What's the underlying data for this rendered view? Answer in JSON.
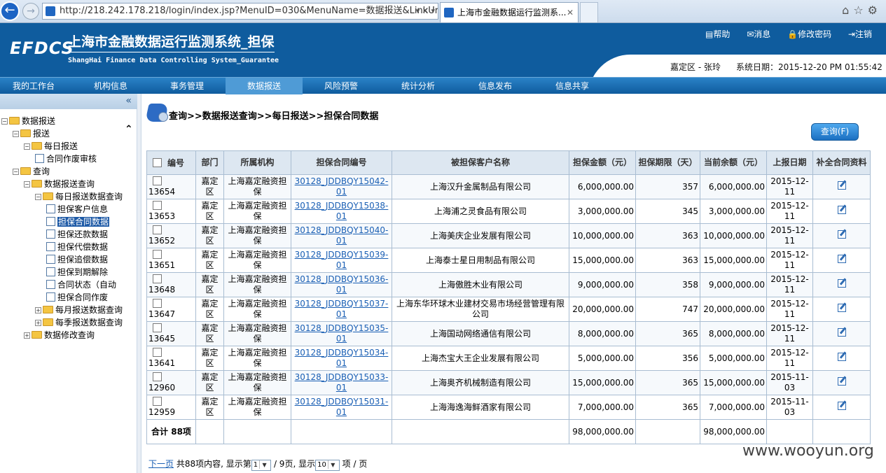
{
  "browser": {
    "url": "http://218.242.178.218/login/index.jsp?MenuID=030&MenuName=数据报送&LinkUr",
    "tab_title": "上海市金融数据运行监测系...",
    "back": "←",
    "forward": "→"
  },
  "header": {
    "logo": "EFDCS",
    "system_name": "上海市金融数据运行监测系统_担保",
    "system_name_en": "ShangHai Finance Data Controlling System_Guarantee",
    "links": [
      "帮助",
      "消息",
      "修改密码",
      "注销"
    ],
    "user": "嘉定区 - 张玲",
    "system_date_label": "系统日期：",
    "system_date": "2015-12-20 PM 01:55:42"
  },
  "nav": {
    "items": [
      "我的工作台",
      "机构信息",
      "事务管理",
      "数据报送",
      "风险预警",
      "统计分析",
      "信息发布",
      "信息共享"
    ],
    "active_index": 3
  },
  "tree": {
    "collapse_label": "«",
    "nodes": [
      {
        "label": "数据报送",
        "level": 0,
        "type": "folder",
        "pm": "−"
      },
      {
        "label": "报送",
        "level": 1,
        "type": "folder",
        "pm": "−"
      },
      {
        "label": "每日报送",
        "level": 2,
        "type": "folder",
        "pm": "−"
      },
      {
        "label": "合同作废审核",
        "level": 3,
        "type": "doc"
      },
      {
        "label": "查询",
        "level": 1,
        "type": "folder",
        "pm": "−"
      },
      {
        "label": "数据报送查询",
        "level": 2,
        "type": "folder",
        "pm": "−"
      },
      {
        "label": "每日报送数据查询",
        "level": 3,
        "type": "folder",
        "pm": "−"
      },
      {
        "label": "担保客户信息",
        "level": 4,
        "type": "doc"
      },
      {
        "label": "担保合同数据",
        "level": 4,
        "type": "doc",
        "selected": true
      },
      {
        "label": "担保还款数据",
        "level": 4,
        "type": "doc"
      },
      {
        "label": "担保代偿数据",
        "level": 4,
        "type": "doc"
      },
      {
        "label": "担保追偿数据",
        "level": 4,
        "type": "doc"
      },
      {
        "label": "担保到期解除",
        "level": 4,
        "type": "doc"
      },
      {
        "label": "合同状态（自动",
        "level": 4,
        "type": "doc"
      },
      {
        "label": "担保合同作废",
        "level": 4,
        "type": "doc"
      },
      {
        "label": "每月报送数据查询",
        "level": 3,
        "type": "folder",
        "pm": "+"
      },
      {
        "label": "每季报送数据查询",
        "level": 3,
        "type": "folder",
        "pm": "+"
      },
      {
        "label": "数据修改查询",
        "level": 2,
        "type": "folder",
        "pm": "+"
      }
    ]
  },
  "main": {
    "breadcrumb": "查询>>数据报送查询>>每日报送>>担保合同数据",
    "query_button": "查询(F)",
    "columns": [
      "编号",
      "部门",
      "所属机构",
      "担保合同编号",
      "被担保客户名称",
      "担保金额（元）",
      "担保期限（天）",
      "当前余额（元）",
      "上报日期",
      "补全合同资料"
    ],
    "rows": [
      {
        "id": "13654",
        "dept": "嘉定区",
        "org": "上海嘉定融资担保",
        "contract": "30128_JDDBQY15042-01",
        "client": "上海汉升金属制品有限公司",
        "amount": "6,000,000.00",
        "days": "357",
        "balance": "6,000,000.00",
        "date": "2015-12-11"
      },
      {
        "id": "13653",
        "dept": "嘉定区",
        "org": "上海嘉定融资担保",
        "contract": "30128_JDDBQY15038-01",
        "client": "上海浦之灵食品有限公司",
        "amount": "3,000,000.00",
        "days": "345",
        "balance": "3,000,000.00",
        "date": "2015-12-11"
      },
      {
        "id": "13652",
        "dept": "嘉定区",
        "org": "上海嘉定融资担保",
        "contract": "30128_JDDBQY15040-01",
        "client": "上海美庆企业发展有限公司",
        "amount": "10,000,000.00",
        "days": "363",
        "balance": "10,000,000.00",
        "date": "2015-12-11"
      },
      {
        "id": "13651",
        "dept": "嘉定区",
        "org": "上海嘉定融资担保",
        "contract": "30128_JDDBQY15039-01",
        "client": "上海泰士星日用制品有限公司",
        "amount": "15,000,000.00",
        "days": "363",
        "balance": "15,000,000.00",
        "date": "2015-12-11"
      },
      {
        "id": "13648",
        "dept": "嘉定区",
        "org": "上海嘉定融资担保",
        "contract": "30128_JDDBQY15036-01",
        "client": "上海傲胜木业有限公司",
        "amount": "9,000,000.00",
        "days": "358",
        "balance": "9,000,000.00",
        "date": "2015-12-11"
      },
      {
        "id": "13647",
        "dept": "嘉定区",
        "org": "上海嘉定融资担保",
        "contract": "30128_JDDBQY15037-01",
        "client": "上海东华环球木业建材交易市场经营管理有限公司",
        "amount": "20,000,000.00",
        "days": "747",
        "balance": "20,000,000.00",
        "date": "2015-12-11"
      },
      {
        "id": "13645",
        "dept": "嘉定区",
        "org": "上海嘉定融资担保",
        "contract": "30128_JDDBQY15035-01",
        "client": "上海国动网络通信有限公司",
        "amount": "8,000,000.00",
        "days": "365",
        "balance": "8,000,000.00",
        "date": "2015-12-11"
      },
      {
        "id": "13641",
        "dept": "嘉定区",
        "org": "上海嘉定融资担保",
        "contract": "30128_JDDBQY15034-01",
        "client": "上海杰宝大王企业发展有限公司",
        "amount": "5,000,000.00",
        "days": "356",
        "balance": "5,000,000.00",
        "date": "2015-12-11"
      },
      {
        "id": "12960",
        "dept": "嘉定区",
        "org": "上海嘉定融资担保",
        "contract": "30128_JDDBQY15033-01",
        "client": "上海奥齐机械制造有限公司",
        "amount": "15,000,000.00",
        "days": "365",
        "balance": "15,000,000.00",
        "date": "2015-11-03"
      },
      {
        "id": "12959",
        "dept": "嘉定区",
        "org": "上海嘉定融资担保",
        "contract": "30128_JDDBQY15031-01",
        "client": "上海海逸海鲜酒家有限公司",
        "amount": "7,000,000.00",
        "days": "365",
        "balance": "7,000,000.00",
        "date": "2015-11-03"
      }
    ],
    "total_label": "合计 88项",
    "total_amount": "98,000,000.00",
    "total_balance": "98,000,000.00",
    "pager": {
      "next": "下一页",
      "text1": "共88项内容, 显示第",
      "page": "1",
      "text2": "/ 9页, 显示",
      "size": "10",
      "text3": "项 / 页"
    }
  },
  "watermark": "www.wooyun.org"
}
